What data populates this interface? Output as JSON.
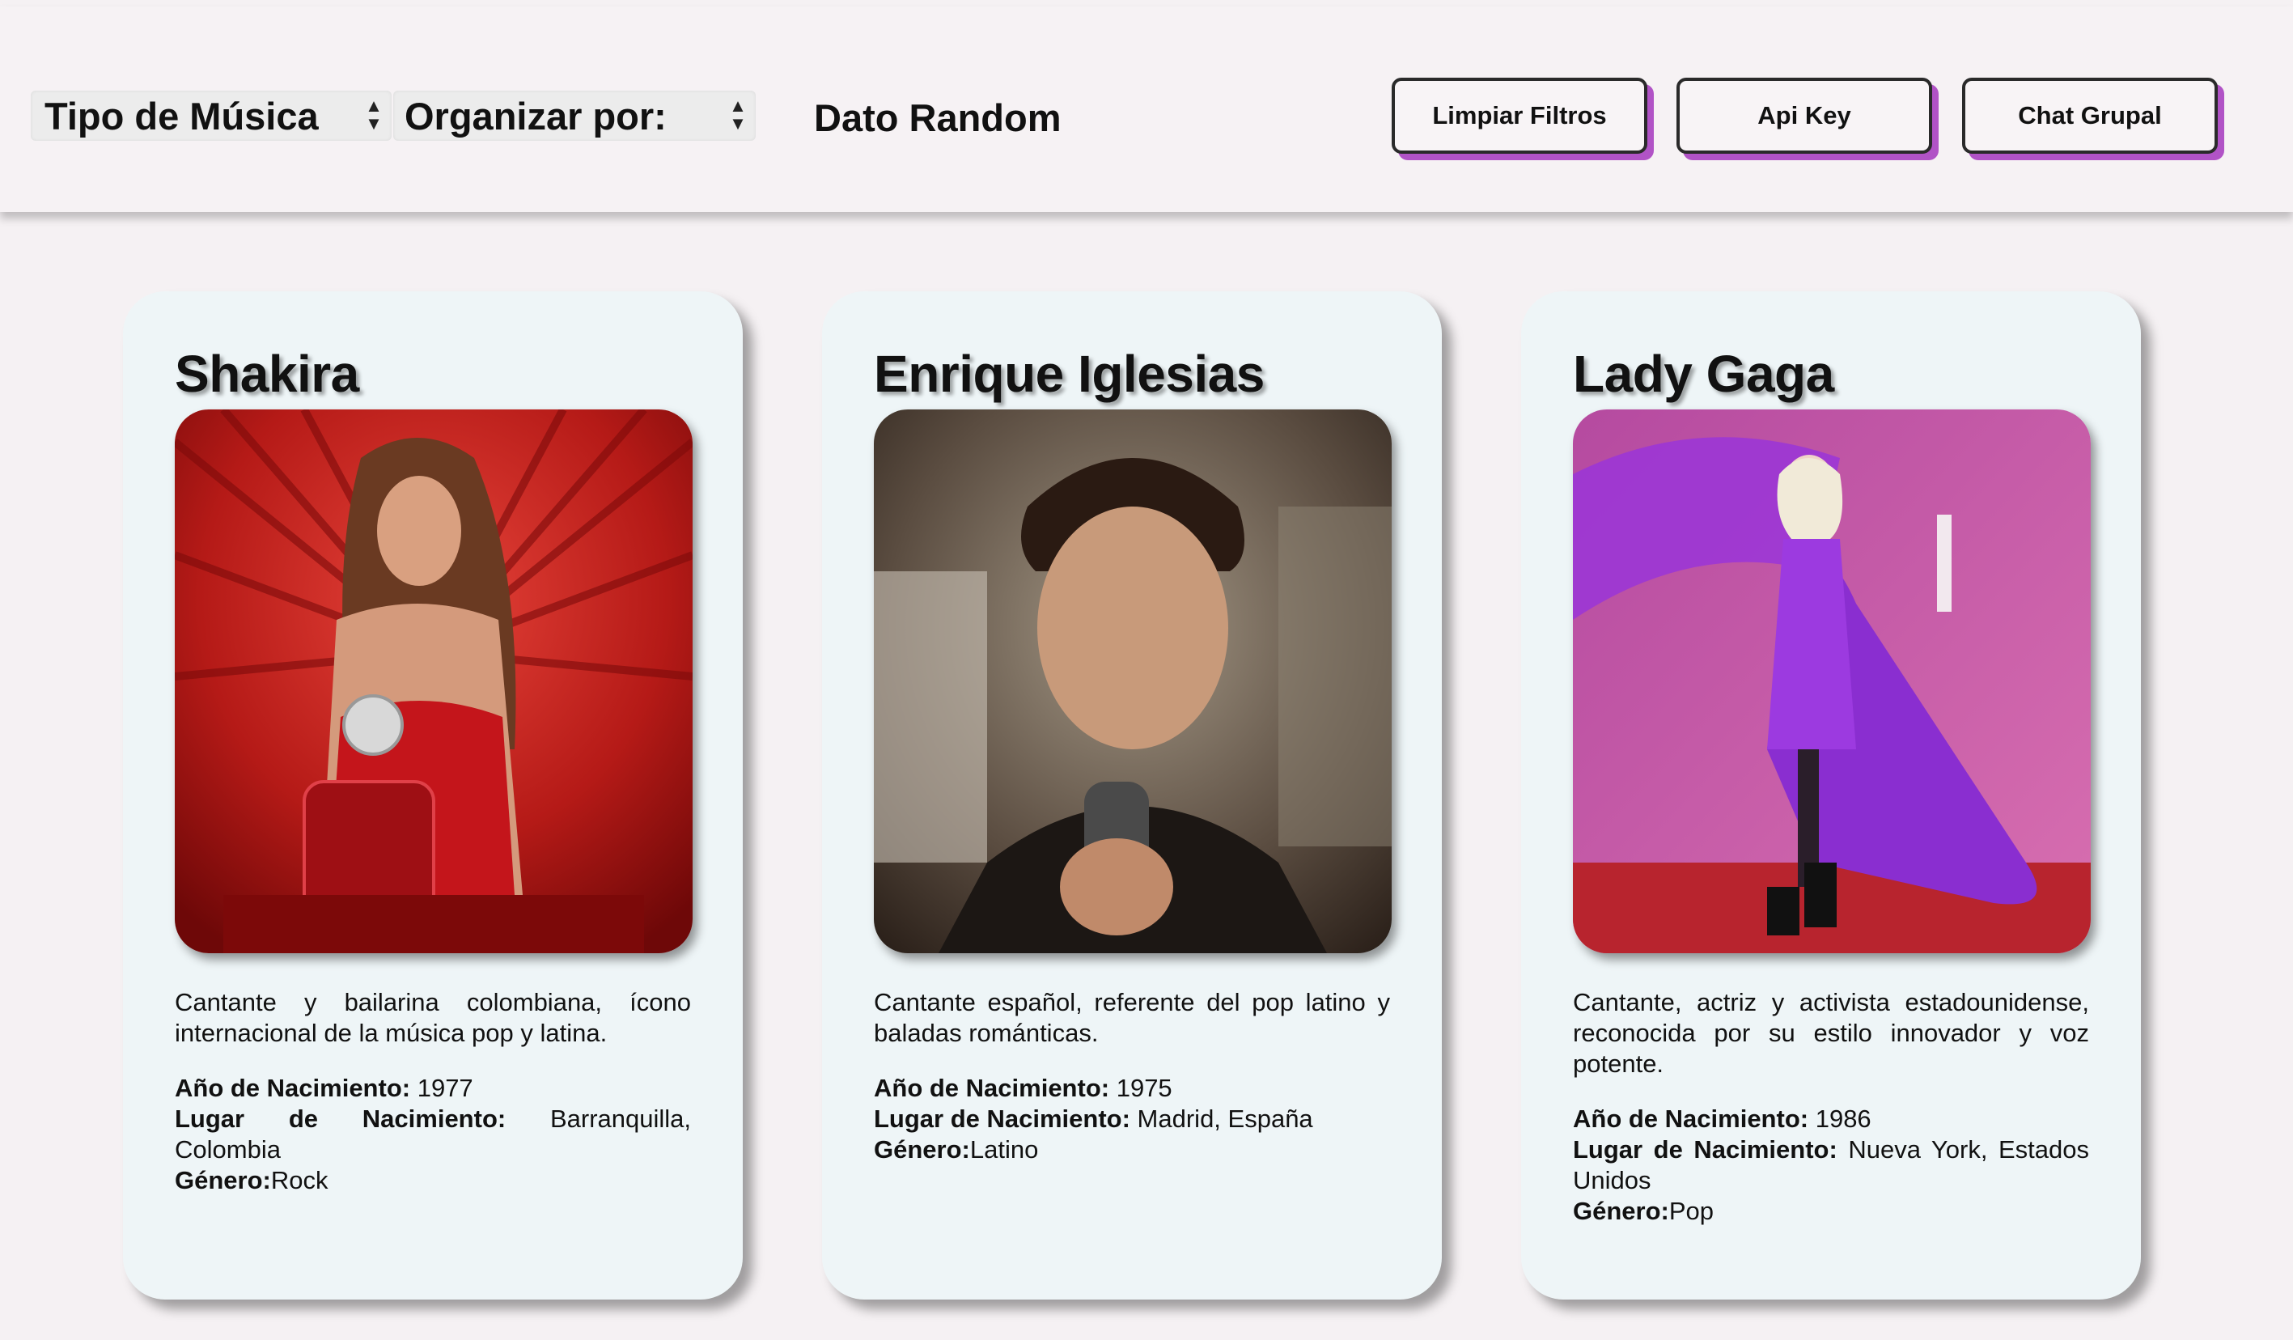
{
  "header": {
    "music_type_select": "Tipo de Música",
    "sort_select": "Organizar por:",
    "random_fact": "Dato Random",
    "clear_filters": "Limpiar Filtros",
    "api_key": "Api Key",
    "group_chat": "Chat Grupal",
    "accent_color": "#b153c6"
  },
  "cards": [
    {
      "name": "Shakira",
      "description": "Cantante y bailarina colombiana, ícono internacional de la música pop y latina.",
      "birth_year_label": "Año de Nacimiento:",
      "birth_year": " 1977",
      "birth_place_label": "Lugar de Nacimiento:",
      "birth_place": " Barranquilla, Colombia",
      "genre_label": "Género:",
      "genre": "Rock"
    },
    {
      "name": "Enrique Iglesias",
      "description": "Cantante español, referente del pop latino y baladas románticas.",
      "birth_year_label": "Año de Nacimiento:",
      "birth_year": " 1975",
      "birth_place_label": "Lugar de Nacimiento:",
      "birth_place": " Madrid, España",
      "genre_label": "Género:",
      "genre": "Latino"
    },
    {
      "name": "Lady Gaga",
      "description": "Cantante, actriz y activista estadounidense, reconocida por su estilo innovador y voz potente.",
      "birth_year_label": "Año de Nacimiento:",
      "birth_year": " 1986",
      "birth_place_label": "Lugar de Nacimiento:",
      "birth_place": " Nueva York, Estados Unidos",
      "genre_label": "Género:",
      "genre": "Pop"
    }
  ]
}
